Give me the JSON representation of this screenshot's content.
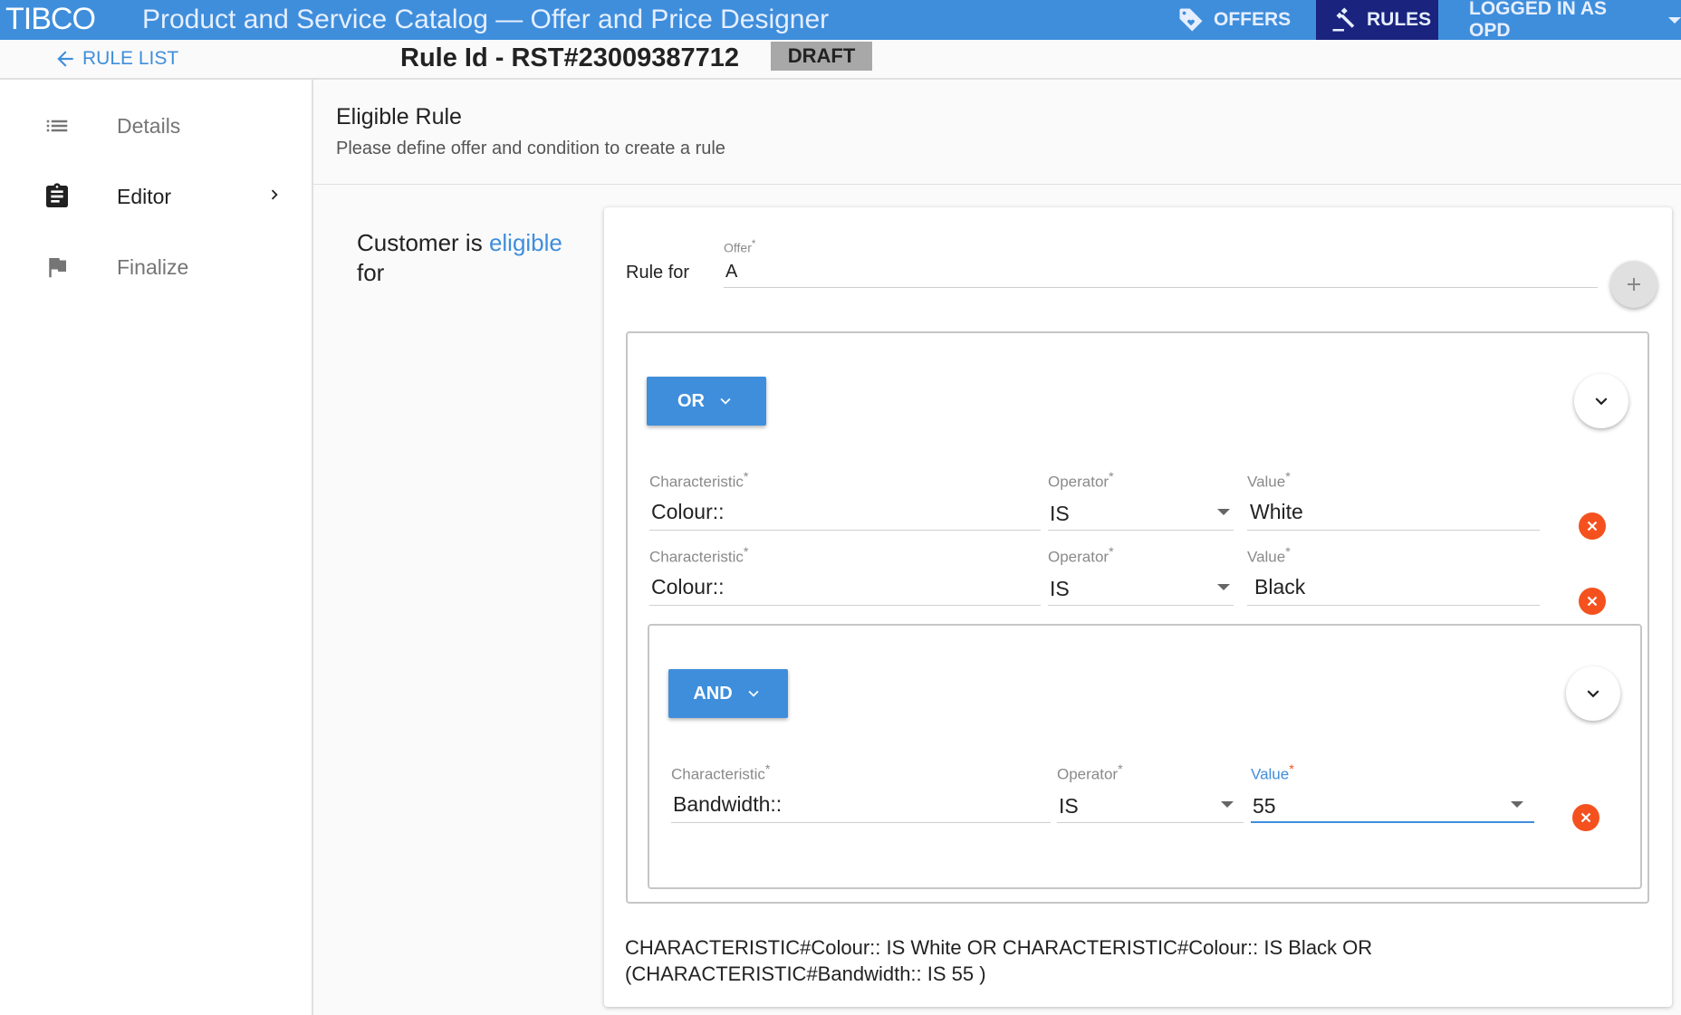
{
  "header": {
    "logo": "TIBCO",
    "title": "Product and Service Catalog — Offer and Price Designer",
    "nav": [
      {
        "label": "OFFERS",
        "icon": "tag-heart-icon"
      },
      {
        "label": "RULES",
        "icon": "gavel-icon",
        "active": true
      }
    ],
    "user": "LOGGED IN AS OPD"
  },
  "subheader": {
    "back_label": "RULE LIST",
    "rule_id": "Rule Id - RST#23009387712",
    "status": "DRAFT"
  },
  "sidebar": {
    "items": [
      {
        "label": "Details",
        "icon": "list-icon"
      },
      {
        "label": "Editor",
        "icon": "clipboard-icon",
        "active": true
      },
      {
        "label": "Finalize",
        "icon": "flag-icon"
      }
    ]
  },
  "main": {
    "title": "Eligible Rule",
    "subtitle": "Please define offer and condition to create a rule",
    "customer_prefix": "Customer is",
    "customer_highlight": "eligible",
    "customer_suffix": "for",
    "rule_for_label": "Rule for",
    "offer_label": "Offer",
    "offer_value": "A",
    "required_mark": "*",
    "or_group": {
      "operator": "OR",
      "conditions": [
        {
          "characteristic_label": "Characteristic",
          "characteristic": "Colour::",
          "operator_label": "Operator",
          "operator": "IS",
          "value_label": "Value",
          "value": "White"
        },
        {
          "characteristic_label": "Characteristic",
          "characteristic": "Colour::",
          "operator_label": "Operator",
          "operator": "IS",
          "value_label": "Value",
          "value": "Black"
        }
      ]
    },
    "and_group": {
      "operator": "AND",
      "conditions": [
        {
          "characteristic_label": "Characteristic",
          "characteristic": "Bandwidth::",
          "operator_label": "Operator",
          "operator": "IS",
          "value_label": "Value",
          "value": "55"
        }
      ]
    },
    "expression_line1": "CHARACTERISTIC#Colour:: IS White OR CHARACTERISTIC#Colour:: IS Black OR",
    "expression_line2": "(CHARACTERISTIC#Bandwidth:: IS 55 )"
  },
  "colors": {
    "primary": "#3f8edc",
    "active_tab": "#1a237e",
    "delete": "#f4511e",
    "draft": "#a8a8a8"
  }
}
